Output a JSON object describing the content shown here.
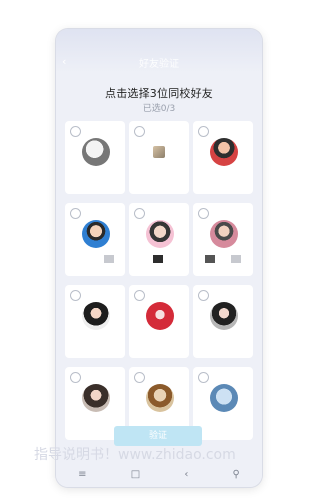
{
  "header": {
    "nav_title": "好友验证",
    "back_icon": "arrow-left-icon"
  },
  "content": {
    "title": "点击选择3位同校好友",
    "selected_text": "已选0/3"
  },
  "cards": [
    {
      "avatar": "avatar-1",
      "selected": false
    },
    {
      "avatar": "avatar-2",
      "selected": false
    },
    {
      "avatar": "avatar-3",
      "selected": false
    },
    {
      "avatar": "avatar-4",
      "selected": false
    },
    {
      "avatar": "avatar-5",
      "selected": false
    },
    {
      "avatar": "avatar-6",
      "selected": false
    },
    {
      "avatar": "avatar-7",
      "selected": false
    },
    {
      "avatar": "avatar-8",
      "selected": false
    },
    {
      "avatar": "avatar-9",
      "selected": false
    },
    {
      "avatar": "avatar-10",
      "selected": false
    },
    {
      "avatar": "avatar-11",
      "selected": false
    },
    {
      "avatar": "avatar-12",
      "selected": false
    }
  ],
  "actions": {
    "verify_label": "验证"
  },
  "system_nav": {
    "menu_icon": "menu-icon",
    "home_icon": "home-icon",
    "back_icon": "back-icon",
    "accessibility_icon": "accessibility-icon"
  },
  "watermark": "指导说明书！www.zhidao.com",
  "colors": {
    "button": "#bfe5f4",
    "background": "#eef0f7"
  }
}
